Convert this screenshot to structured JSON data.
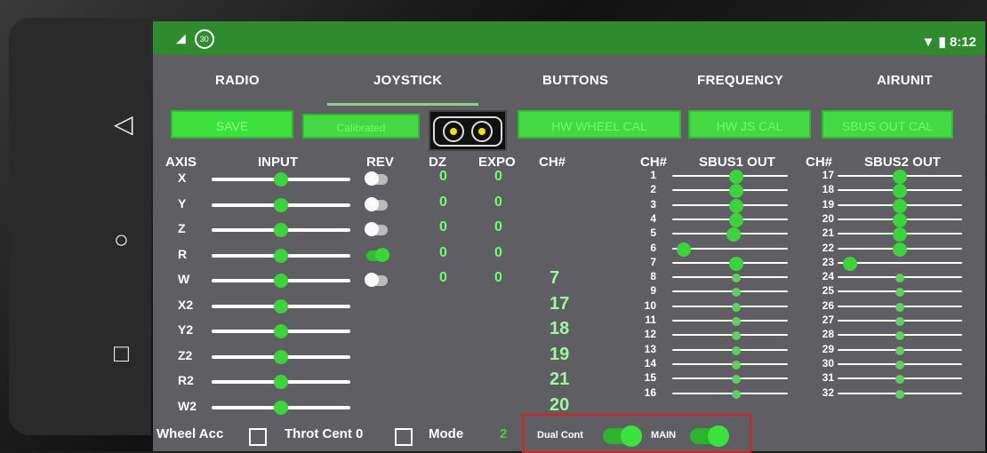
{
  "status": {
    "badge": "30",
    "time": "8:12"
  },
  "tabs": [
    "RADIO",
    "JOYSTICK",
    "BUTTONS",
    "FREQUENCY",
    "AIRUNIT"
  ],
  "buttons": {
    "save": "SAVE",
    "calibrated": "Calibrated",
    "hw_wheel": "HW WHEEL CAL",
    "hw_js": "HW JS CAL",
    "sbus_out": "SBUS OUT CAL"
  },
  "headers": {
    "axis": "AXIS",
    "input": "INPUT",
    "rev": "REV",
    "dz": "DZ",
    "expo": "EXPO",
    "ch": "CH#",
    "ch2": "CH#",
    "sbus1": "SBUS1 OUT",
    "ch3": "CH#",
    "sbus2": "SBUS2 OUT"
  },
  "axes": [
    {
      "name": "X",
      "input": 0.5,
      "rev": false,
      "dz": "0",
      "expo": "0"
    },
    {
      "name": "Y",
      "input": 0.5,
      "rev": false,
      "dz": "0",
      "expo": "0"
    },
    {
      "name": "Z",
      "input": 0.5,
      "rev": false,
      "dz": "0",
      "expo": "0"
    },
    {
      "name": "R",
      "input": 0.5,
      "rev": true,
      "dz": "0",
      "expo": "0"
    },
    {
      "name": "W",
      "input": 0.5,
      "rev": false,
      "dz": "0",
      "expo": "0",
      "ch": "7"
    },
    {
      "name": "X2",
      "input": 0.5,
      "ch": "17"
    },
    {
      "name": "Y2",
      "input": 0.5,
      "ch": "18"
    },
    {
      "name": "Z2",
      "input": 0.5,
      "ch": "19"
    },
    {
      "name": "R2",
      "input": 0.5,
      "ch": "21"
    },
    {
      "name": "W2",
      "input": 0.5,
      "ch": "20"
    }
  ],
  "sbus1": [
    {
      "ch": "1",
      "v": 0.55
    },
    {
      "ch": "2",
      "v": 0.55
    },
    {
      "ch": "3",
      "v": 0.55
    },
    {
      "ch": "4",
      "v": 0.55
    },
    {
      "ch": "5",
      "v": 0.53
    },
    {
      "ch": "6",
      "v": 0.1
    },
    {
      "ch": "7",
      "v": 0.55
    },
    {
      "ch": "8",
      "v": 0.55
    },
    {
      "ch": "9",
      "v": 0.55
    },
    {
      "ch": "10",
      "v": 0.55
    },
    {
      "ch": "11",
      "v": 0.55
    },
    {
      "ch": "12",
      "v": 0.55
    },
    {
      "ch": "13",
      "v": 0.55
    },
    {
      "ch": "14",
      "v": 0.55
    },
    {
      "ch": "15",
      "v": 0.55
    },
    {
      "ch": "16",
      "v": 0.55
    }
  ],
  "sbus2": [
    {
      "ch": "17",
      "v": 0.5
    },
    {
      "ch": "18",
      "v": 0.5
    },
    {
      "ch": "19",
      "v": 0.5
    },
    {
      "ch": "20",
      "v": 0.5
    },
    {
      "ch": "21",
      "v": 0.5
    },
    {
      "ch": "22",
      "v": 0.5
    },
    {
      "ch": "23",
      "v": 0.1
    },
    {
      "ch": "24",
      "v": 0.5
    },
    {
      "ch": "25",
      "v": 0.5
    },
    {
      "ch": "26",
      "v": 0.5
    },
    {
      "ch": "27",
      "v": 0.5
    },
    {
      "ch": "28",
      "v": 0.5
    },
    {
      "ch": "29",
      "v": 0.5
    },
    {
      "ch": "30",
      "v": 0.5
    },
    {
      "ch": "31",
      "v": 0.5
    },
    {
      "ch": "32",
      "v": 0.5
    }
  ],
  "bottom": {
    "wheel_acc": "Wheel Acc",
    "throt_cent": "Throt Cent 0",
    "mode": "Mode",
    "mode_val": "2",
    "dual_cont": "Dual Cont",
    "main": "MAIN"
  },
  "colors": {
    "accent": "#3cd43c",
    "status_bar": "#2e8b2e",
    "highlight": "#d8201f"
  }
}
